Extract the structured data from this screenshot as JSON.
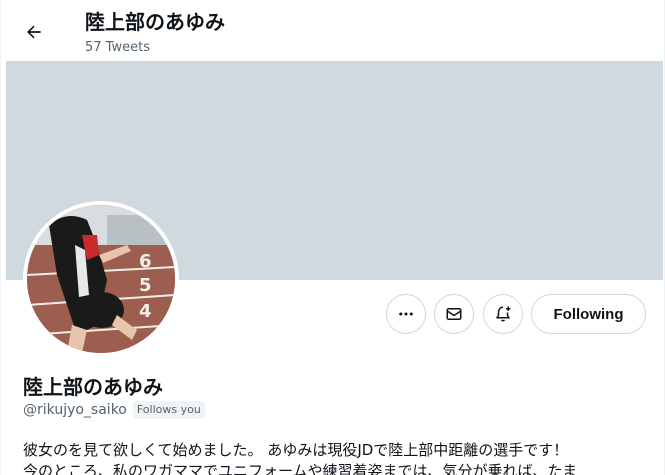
{
  "header": {
    "title": "陸上部のあゆみ",
    "tweet_count": "57 Tweets"
  },
  "actions": {
    "following_label": "Following"
  },
  "profile": {
    "name": "陸上部のあゆみ",
    "handle": "@rikujyo_saiko",
    "follows_you": "Follows you",
    "bio_line1": "彼女のを見て欲しくて始めました。 あゆみは現役JDで陸上部中距離の選手です！",
    "bio_line2": "今のところ、私のワガママでユニフォームや練習着姿までは、気分が乗れば、たま"
  },
  "icons": {
    "back": "back-arrow-icon",
    "more": "more-horizontal-icon",
    "mail": "mail-icon",
    "notify": "notification-bell-plus-icon"
  },
  "colors": {
    "banner": "#cfd9de",
    "text_primary": "#0f1419",
    "text_secondary": "#536471",
    "border": "#cfd9de"
  }
}
